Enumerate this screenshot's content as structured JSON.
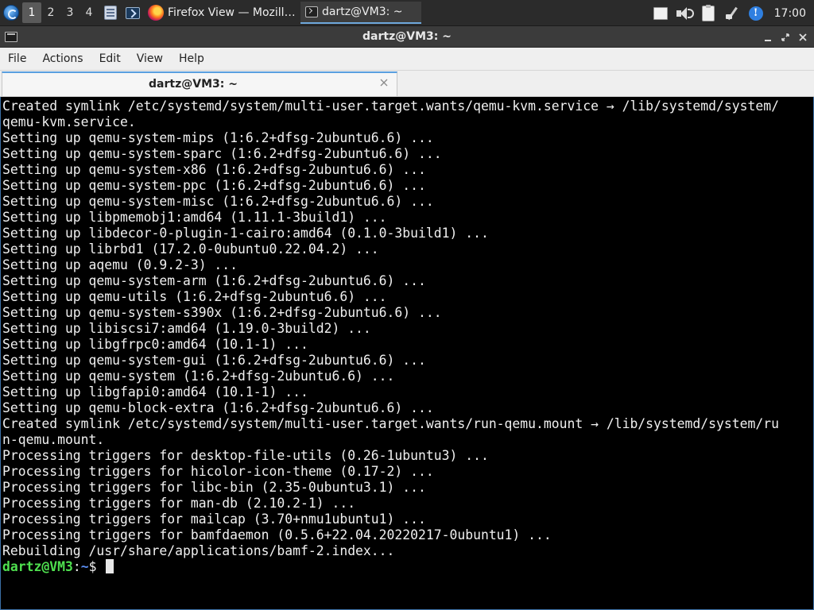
{
  "panel": {
    "workspaces": [
      "1",
      "2",
      "3",
      "4"
    ],
    "active_workspace": "1",
    "tasks": [
      {
        "label": "Firefox View — Mozill…",
        "icon": "firefox-icon"
      },
      {
        "label": "dartz@VM3: ~",
        "icon": "terminal-icon"
      }
    ],
    "tray_icons": [
      "notes-icon",
      "volume-icon",
      "clipboard-icon",
      "network-icon",
      "info-icon"
    ],
    "clock": "17:00"
  },
  "window": {
    "title": "dartz@VM3: ~",
    "controls": [
      "minimize",
      "maximize",
      "close"
    ]
  },
  "menubar": {
    "items": [
      "File",
      "Actions",
      "Edit",
      "View",
      "Help"
    ]
  },
  "tabs": [
    {
      "label": "dartz@VM3: ~"
    }
  ],
  "terminal": {
    "lines": [
      "Created symlink /etc/systemd/system/multi-user.target.wants/qemu-kvm.service → /lib/systemd/system/",
      "qemu-kvm.service.",
      "Setting up qemu-system-mips (1:6.2+dfsg-2ubuntu6.6) ...",
      "Setting up qemu-system-sparc (1:6.2+dfsg-2ubuntu6.6) ...",
      "Setting up qemu-system-x86 (1:6.2+dfsg-2ubuntu6.6) ...",
      "Setting up qemu-system-ppc (1:6.2+dfsg-2ubuntu6.6) ...",
      "Setting up qemu-system-misc (1:6.2+dfsg-2ubuntu6.6) ...",
      "Setting up libpmemobj1:amd64 (1.11.1-3build1) ...",
      "Setting up libdecor-0-plugin-1-cairo:amd64 (0.1.0-3build1) ...",
      "Setting up librbd1 (17.2.0-0ubuntu0.22.04.2) ...",
      "Setting up aqemu (0.9.2-3) ...",
      "Setting up qemu-system-arm (1:6.2+dfsg-2ubuntu6.6) ...",
      "Setting up qemu-utils (1:6.2+dfsg-2ubuntu6.6) ...",
      "Setting up qemu-system-s390x (1:6.2+dfsg-2ubuntu6.6) ...",
      "Setting up libiscsi7:amd64 (1.19.0-3build2) ...",
      "Setting up libgfrpc0:amd64 (10.1-1) ...",
      "Setting up qemu-system-gui (1:6.2+dfsg-2ubuntu6.6) ...",
      "Setting up qemu-system (1:6.2+dfsg-2ubuntu6.6) ...",
      "Setting up libgfapi0:amd64 (10.1-1) ...",
      "Setting up qemu-block-extra (1:6.2+dfsg-2ubuntu6.6) ...",
      "Created symlink /etc/systemd/system/multi-user.target.wants/run-qemu.mount → /lib/systemd/system/ru",
      "n-qemu.mount.",
      "Processing triggers for desktop-file-utils (0.26-1ubuntu3) ...",
      "Processing triggers for hicolor-icon-theme (0.17-2) ...",
      "Processing triggers for libc-bin (2.35-0ubuntu3.1) ...",
      "Processing triggers for man-db (2.10.2-1) ...",
      "Processing triggers for mailcap (3.70+nmu1ubuntu1) ...",
      "Processing triggers for bamfdaemon (0.5.6+22.04.20220217-0ubuntu1) ...",
      "Rebuilding /usr/share/applications/bamf-2.index..."
    ],
    "prompt": {
      "user_host": "dartz@VM3",
      "separator": ":",
      "path": "~",
      "symbol": "$ "
    },
    "colors": {
      "background": "#000000",
      "text": "#f0f0f0",
      "prompt_user": "#4fe04f",
      "prompt_path": "#5a8cf0"
    }
  }
}
